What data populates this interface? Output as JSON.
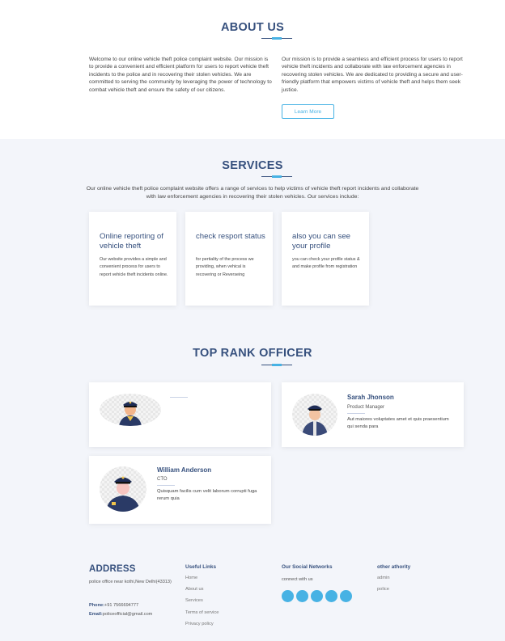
{
  "about": {
    "title": "ABOUT US",
    "left_text": "Welcome to our online vehicle theft police complaint website. Our mission is to provide a convenient and efficient platform for users to report vehicle theft incidents to the police and in recovering their stolen vehicles. We are committed to serving the community by leveraging the power of technology to combat vehicle theft and ensure the safety of our citizens.",
    "right_text": "Our mission is to provide a seamless and efficient process for users to report vehicle theft incidents and collaborate with law enforcement agencies in recovering stolen vehicles. We are dedicated to providing a secure and user-friendly platform that empowers victims of vehicle theft and helps them seek justice.",
    "button": "Learn More"
  },
  "services": {
    "title": "SERVICES",
    "description": "Our online vehicle theft police complaint website offers a range of services to help victims of vehicle theft report incidents and collaborate with law enforcement agencies in recovering their stolen vehicles. Our services include:",
    "cards": [
      {
        "title": "Online reporting of vehicle theft",
        "text": "Our website provides a simple and convenient process for users to report vehicle theft incidents online."
      },
      {
        "title": "check resport status",
        "text": "for pertiality of the process we providing, when vehical is recovering or Reverseing"
      },
      {
        "title": "also you can see your profile",
        "text": "you can check your profile status & and make profile from registration"
      }
    ]
  },
  "officers": {
    "title": "TOP RANK OFFICER",
    "members": [
      {
        "name": "",
        "role": "",
        "text": ""
      },
      {
        "name": "Sarah Jhonson",
        "role": "Product Manager",
        "text": "Aut maiores voluptates amet et quis praesentium qui senda para"
      },
      {
        "name": "William Anderson",
        "role": "CTO",
        "text": "Quisquam facilis cum velit laborum corrupti fuga rerum quia"
      }
    ]
  },
  "footer": {
    "address_title": "ADDRESS",
    "address_line": "police office near kothi,New Delhi(43313)",
    "phone_label": "Phone:",
    "phone": "+91 7566694777",
    "email_label": "Email:",
    "email": "policeofficial@gmail.com",
    "links_title": "Useful Links",
    "links": [
      "Home",
      "About us",
      "Services",
      "Terms of service",
      "Privacy policy"
    ],
    "social_title": "Our Social Networks",
    "social_text": "connect with us",
    "other_title": "other athority",
    "other_links": [
      "admin",
      "police"
    ]
  },
  "colors": {
    "primary": "#37517e",
    "accent": "#47b2e4",
    "bg_alt": "#f3f5fa"
  }
}
